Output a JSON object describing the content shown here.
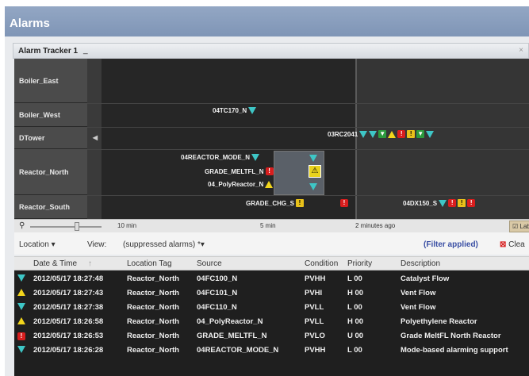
{
  "window": {
    "title": "Alarms"
  },
  "panel": {
    "title": "Alarm Tracker 1",
    "minimize": "_"
  },
  "tracker": {
    "rows": [
      "Boiler_East",
      "Boiler_West",
      "DTower",
      "Reactor_North",
      "Reactor_South"
    ],
    "events": {
      "e1": "04TC170_N",
      "e2": "03RC2041",
      "e3": "04REACTOR_MODE_N",
      "e4": "GRADE_MELTFL_N",
      "e5": "04_PolyReactor_N",
      "e6": "GRADE_CHG_S",
      "e7": "04DX150_S"
    }
  },
  "axis": {
    "t1": "10 min",
    "t2": "5 min",
    "t3": "2 minutes ago",
    "labels_toggle": "Labels"
  },
  "toolbar": {
    "location": "Location",
    "view": "View:",
    "suppressed": "(suppressed alarms)",
    "filter": "(Filter applied)",
    "clear": "Clea"
  },
  "table": {
    "headers": [
      "Date & Time",
      "Location Tag",
      "Source",
      "Condition",
      "Priority",
      "Description"
    ],
    "rows": [
      {
        "icon": "cyan-triangle-down",
        "datetime": "2012/05/17 18:27:48",
        "location": "Reactor_North",
        "source": "04FC100_N",
        "condition": "PVHH",
        "priority": "L 00",
        "description": "Catalyst Flow"
      },
      {
        "icon": "yellow-triangle-up",
        "datetime": "2012/05/17 18:27:43",
        "location": "Reactor_North",
        "source": "04FC101_N",
        "condition": "PVHI",
        "priority": "H 00",
        "description": "Vent Flow"
      },
      {
        "icon": "cyan-triangle-down",
        "datetime": "2012/05/17 18:27:38",
        "location": "Reactor_North",
        "source": "04FC110_N",
        "condition": "PVLL",
        "priority": "L 00",
        "description": "Vent Flow"
      },
      {
        "icon": "yellow-triangle-up",
        "datetime": "2012/05/17 18:26:58",
        "location": "Reactor_North",
        "source": "04_PolyReactor_N",
        "condition": "PVLL",
        "priority": "H 00",
        "description": "Polyethylene Reactor"
      },
      {
        "icon": "red-exclamation",
        "datetime": "2012/05/17 18:26:53",
        "location": "Reactor_North",
        "source": "GRADE_MELTFL_N",
        "condition": "PVLO",
        "priority": "U 00",
        "description": "Grade MeltFL North Reactor"
      },
      {
        "icon": "cyan-triangle-down",
        "datetime": "2012/05/17 18:26:28",
        "location": "Reactor_North",
        "source": "04REACTOR_MODE_N",
        "condition": "PVHH",
        "priority": "L 00",
        "description": "Mode-based alarming support"
      }
    ]
  }
}
